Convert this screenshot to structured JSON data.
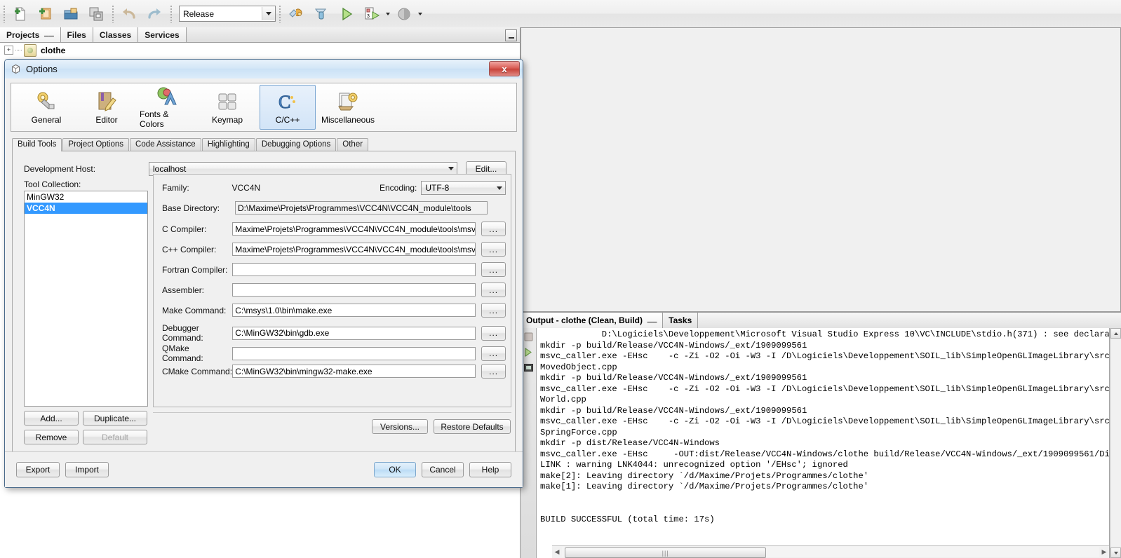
{
  "toolbar": {
    "buttons": [
      {
        "name": "new-file-icon",
        "title": "New File"
      },
      {
        "name": "new-project-icon",
        "title": "New Project"
      },
      {
        "name": "open-project-icon",
        "title": "Open Project"
      },
      {
        "name": "save-all-icon",
        "title": "Save All"
      },
      {
        "name": "undo-icon",
        "title": "Undo"
      },
      {
        "name": "redo-icon",
        "title": "Redo"
      }
    ],
    "config_combo": {
      "value": "Release"
    },
    "run_buttons": [
      {
        "name": "build-project-icon",
        "title": "Build Project"
      },
      {
        "name": "clean-build-icon",
        "title": "Clean and Build Project"
      },
      {
        "name": "run-project-icon",
        "title": "Run Project"
      },
      {
        "name": "debug-project-icon",
        "title": "Debug Project"
      },
      {
        "name": "profile-project-icon",
        "title": "Profile Project"
      }
    ]
  },
  "explorer": {
    "tabs": [
      {
        "label": "Projects",
        "active": true,
        "pinned": true
      },
      {
        "label": "Files",
        "active": false,
        "pinned": false
      },
      {
        "label": "Classes",
        "active": false,
        "pinned": false
      },
      {
        "label": "Services",
        "active": false,
        "pinned": false
      }
    ],
    "tree": {
      "expander": "+",
      "project_name": "clothe"
    }
  },
  "output": {
    "tabs": [
      {
        "label": "Output - clothe (Clean, Build)",
        "active": true,
        "pinned": true
      },
      {
        "label": "Tasks",
        "active": false,
        "pinned": false
      }
    ],
    "gutter_icons": [
      "stop-build-icon",
      "rerun-icon",
      "clear-output-icon"
    ],
    "log": "            D:\\Logiciels\\Developpement\\Microsoft Visual Studio Express 10\\VC\\INCLUDE\\stdio.h(371) : see declaration of\nmkdir -p build/Release/VCC4N-Windows/_ext/1909099561\nmsvc_caller.exe -EHsc    -c -Zi -O2 -Oi -W3 -I /D\\Logiciels\\Developpement\\SOIL_lib\\SimpleOpenGLImageLibrary\\src -Fo\nMovedObject.cpp\nmkdir -p build/Release/VCC4N-Windows/_ext/1909099561\nmsvc_caller.exe -EHsc    -c -Zi -O2 -Oi -W3 -I /D\\Logiciels\\Developpement\\SOIL_lib\\SimpleOpenGLImageLibrary\\src -Fo\nWorld.cpp\nmkdir -p build/Release/VCC4N-Windows/_ext/1909099561\nmsvc_caller.exe -EHsc    -c -Zi -O2 -Oi -W3 -I /D\\Logiciels\\Developpement\\SOIL_lib\\SimpleOpenGLImageLibrary\\src -Fo\nSpringForce.cpp\nmkdir -p dist/Release/VCC4N-Windows\nmsvc_caller.exe -EHsc     -OUT:dist/Release/VCC4N-Windows/clothe build/Release/VCC4N-Windows/_ext/1909099561/Dist\nLINK : warning LNK4044: unrecognized option '/EHsc'; ignored\nmake[2]: Leaving directory `/d/Maxime/Projets/Programmes/clothe'\nmake[1]: Leaving directory `/d/Maxime/Projets/Programmes/clothe'\n\n\nBUILD SUCCESSFUL (total time: 17s)"
  },
  "dialog": {
    "title": "Options",
    "close_label": "x",
    "categories": [
      {
        "label": "General",
        "icon": "gear-wrench-icon",
        "selected": false
      },
      {
        "label": "Editor",
        "icon": "book-pencil-icon",
        "selected": false
      },
      {
        "label": "Fonts & Colors",
        "icon": "font-palette-icon",
        "selected": false
      },
      {
        "label": "Keymap",
        "icon": "keyboard-keys-icon",
        "selected": false
      },
      {
        "label": "C/C++",
        "icon": "c-language-icon",
        "selected": true
      },
      {
        "label": "Miscellaneous",
        "icon": "documents-gear-icon",
        "selected": false
      }
    ],
    "tabs": [
      {
        "label": "Build Tools",
        "active": true
      },
      {
        "label": "Project Options",
        "active": false
      },
      {
        "label": "Code Assistance",
        "active": false
      },
      {
        "label": "Highlighting",
        "active": false
      },
      {
        "label": "Debugging Options",
        "active": false
      },
      {
        "label": "Other",
        "active": false
      }
    ],
    "build_tools": {
      "dev_host_label": "Development Host:",
      "dev_host_value": "localhost",
      "edit_button": "Edit...",
      "tool_collection_label": "Tool Collection:",
      "tool_collections": [
        {
          "label": "MinGW32",
          "selected": false
        },
        {
          "label": "VCC4N",
          "selected": true
        }
      ],
      "list_buttons": [
        {
          "label": "Add...",
          "disabled": false
        },
        {
          "label": "Duplicate...",
          "disabled": false
        },
        {
          "label": "Remove",
          "disabled": false
        },
        {
          "label": "Default",
          "disabled": true
        }
      ],
      "family_label": "Family:",
      "family_value": "VCC4N",
      "encoding_label": "Encoding:",
      "encoding_value": "UTF-8",
      "fields": [
        {
          "label": "Base Directory:",
          "value": "D:\\Maxime\\Projets\\Programmes\\VCC4N\\VCC4N_module\\tools",
          "browse": false,
          "readonly": true
        },
        {
          "label": "C Compiler:",
          "value": "Maxime\\Projets\\Programmes\\VCC4N\\VCC4N_module\\tools\\msvc_caller.exe",
          "browse": true,
          "readonly": false
        },
        {
          "label": "C++ Compiler:",
          "value": "Maxime\\Projets\\Programmes\\VCC4N\\VCC4N_module\\tools\\msvc_caller.exe",
          "browse": true,
          "readonly": false
        },
        {
          "label": "Fortran Compiler:",
          "value": "",
          "browse": true,
          "readonly": false
        },
        {
          "label": "Assembler:",
          "value": "",
          "browse": true,
          "readonly": false
        },
        {
          "label": "Make Command:",
          "value": "C:\\msys\\1.0\\bin\\make.exe",
          "browse": true,
          "readonly": false
        },
        {
          "label": "Debugger Command:",
          "value": "C:\\MinGW32\\bin\\gdb.exe",
          "browse": true,
          "readonly": false
        },
        {
          "label": "QMake Command:",
          "value": "",
          "browse": true,
          "readonly": false
        },
        {
          "label": "CMake Command:",
          "value": "C:\\MinGW32\\bin\\mingw32-make.exe",
          "browse": true,
          "readonly": false
        }
      ],
      "browse_label": "...",
      "versions_button": "Versions...",
      "restore_defaults_button": "Restore Defaults"
    },
    "footer": {
      "export_button": "Export",
      "import_button": "Import",
      "ok_button": "OK",
      "cancel_button": "Cancel",
      "help_button": "Help"
    }
  },
  "colors": {
    "selection_blue": "#3399ff",
    "dialog_border": "#4a6a8a",
    "close_red": "#c9443c",
    "panel_bg": "#f0f0f0"
  }
}
